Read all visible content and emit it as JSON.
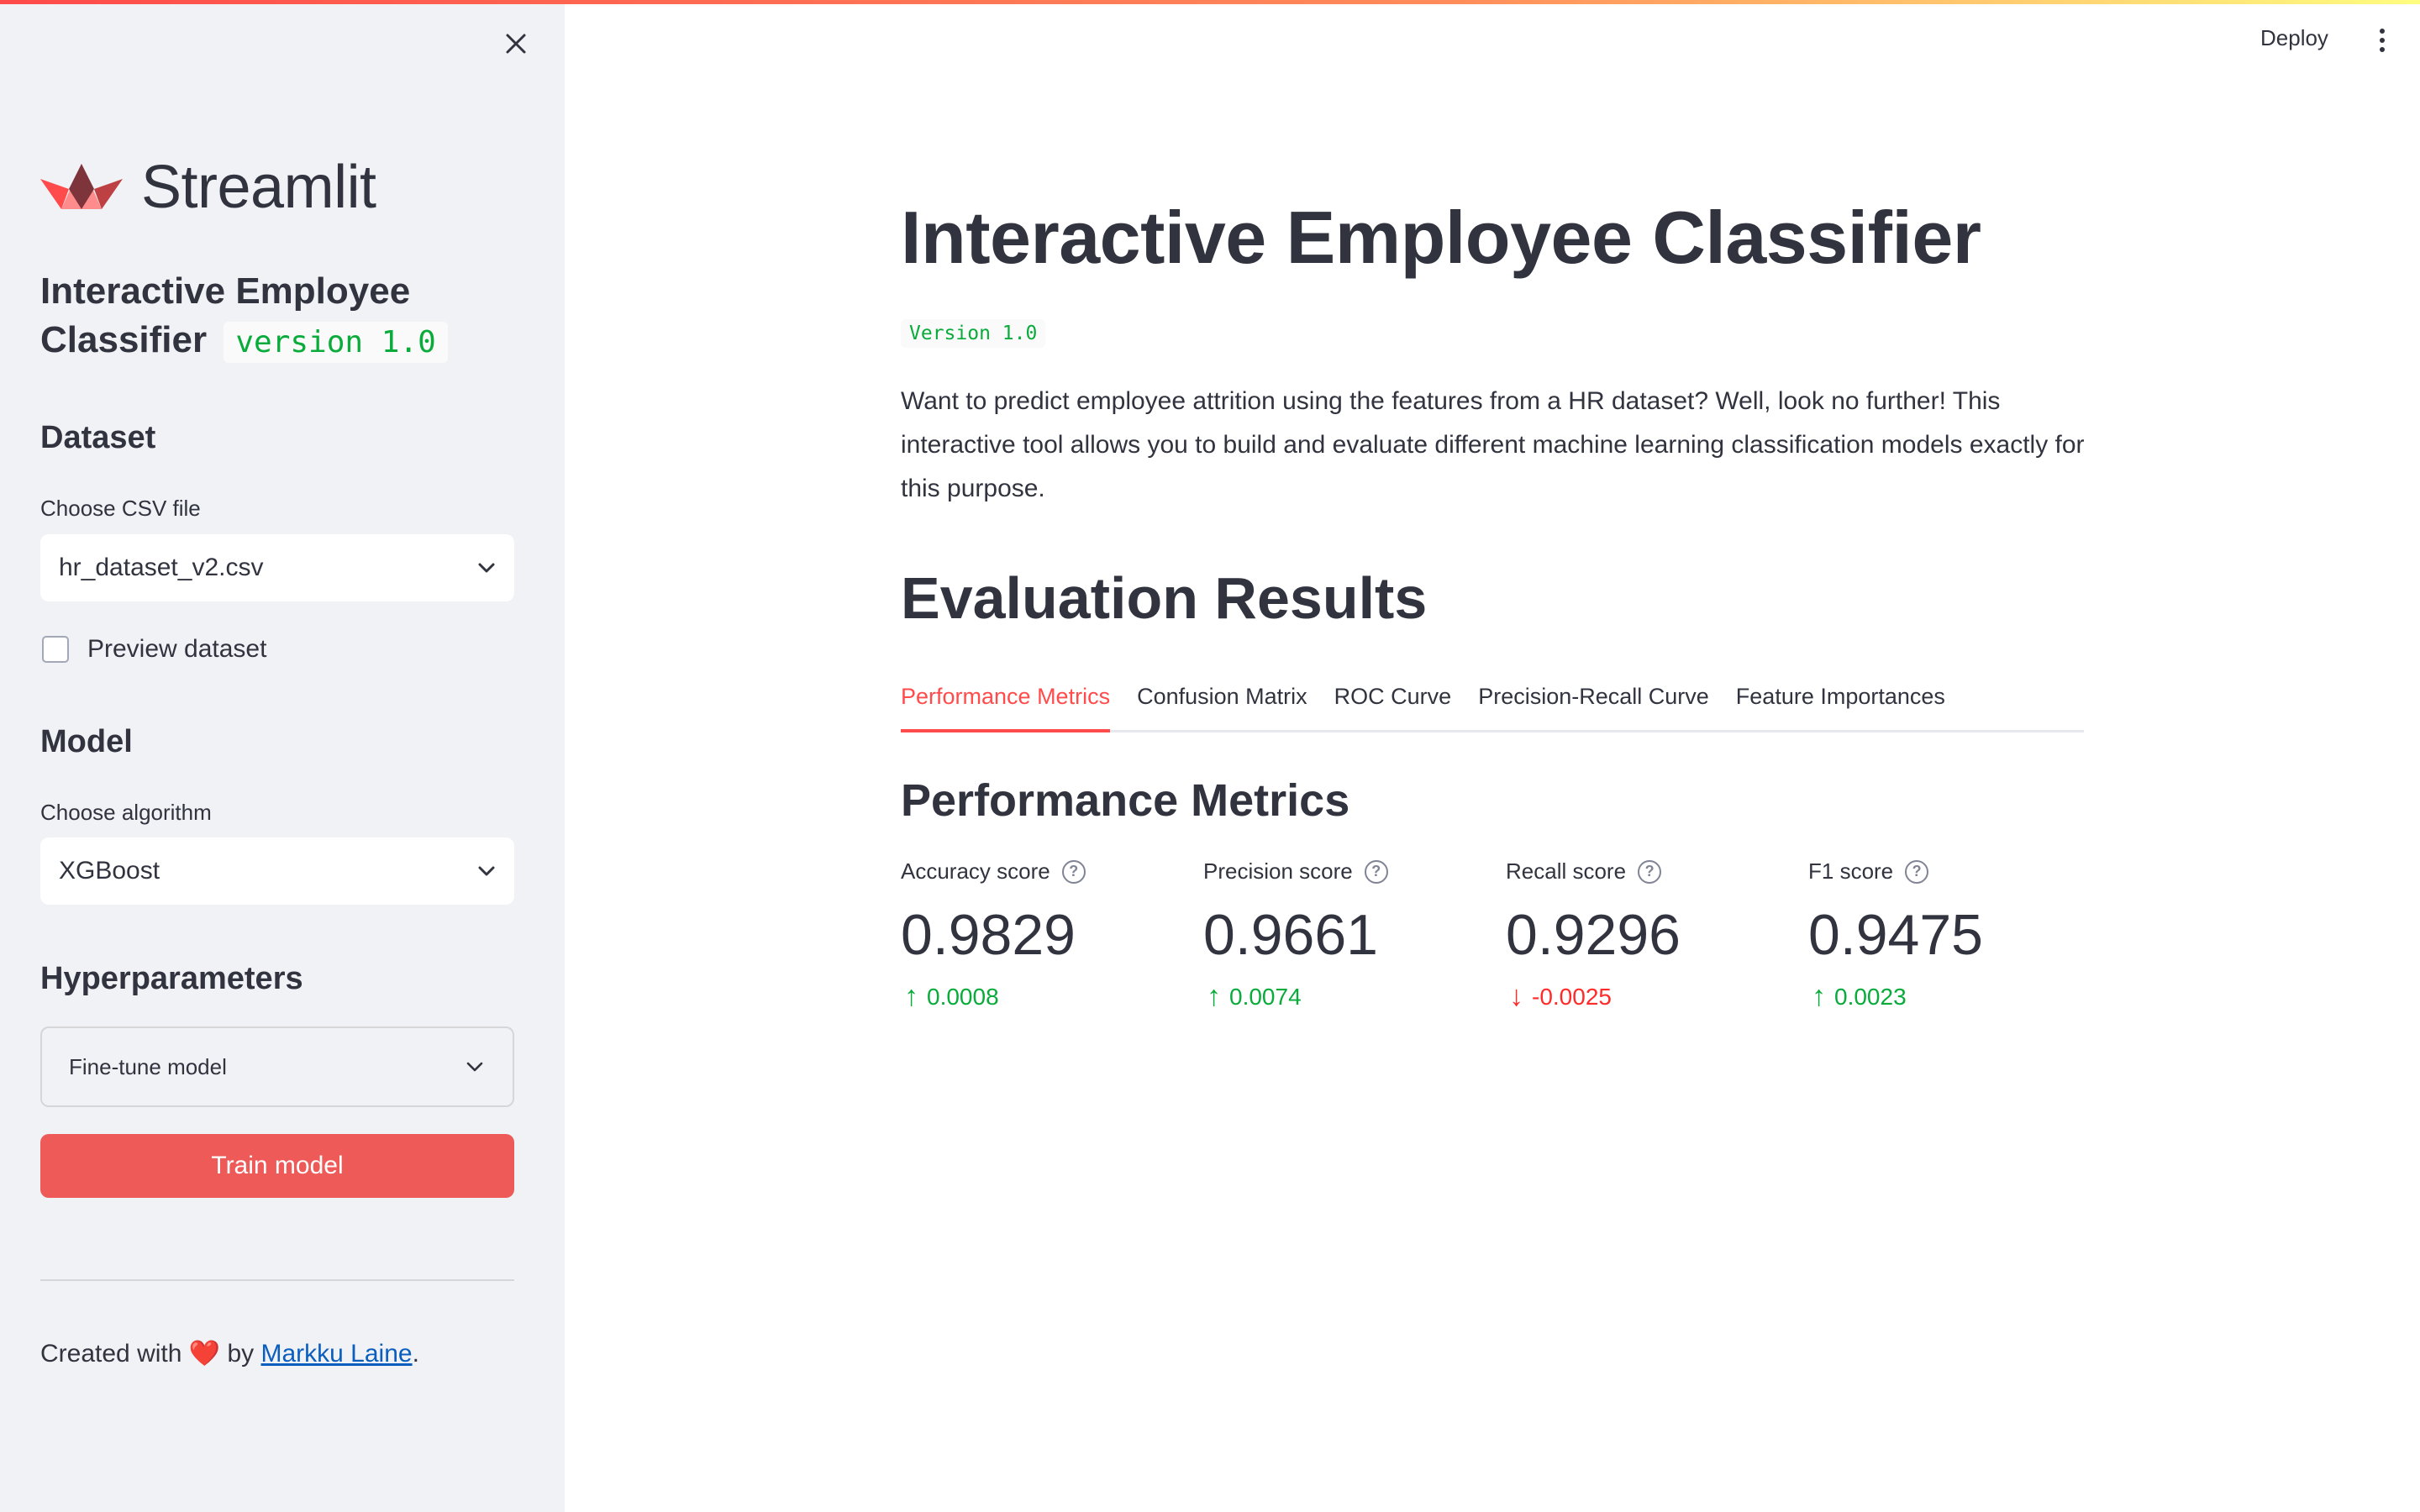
{
  "header": {
    "deploy_label": "Deploy"
  },
  "sidebar": {
    "logo_text": "Streamlit",
    "app_title": "Interactive Employee Classifier",
    "app_version": "version 1.0",
    "dataset": {
      "heading": "Dataset",
      "file_label": "Choose CSV file",
      "file_value": "hr_dataset_v2.csv",
      "preview_label": "Preview dataset",
      "preview_checked": false
    },
    "model": {
      "heading": "Model",
      "algorithm_label": "Choose algorithm",
      "algorithm_value": "XGBoost"
    },
    "hyperparameters": {
      "heading": "Hyperparameters",
      "expander_label": "Fine-tune model",
      "train_button": "Train model"
    },
    "footer": {
      "prefix": "Created with",
      "by": "by",
      "author": "Markku Laine",
      "suffix": "."
    }
  },
  "main": {
    "title": "Interactive Employee Classifier",
    "version": "Version 1.0",
    "intro": "Want to predict employee attrition using the features from a HR dataset? Well, look no further! This interactive tool allows you to build and evaluate different machine learning classification models exactly for this purpose.",
    "results_heading": "Evaluation Results",
    "tabs": [
      {
        "label": "Performance Metrics",
        "active": true
      },
      {
        "label": "Confusion Matrix",
        "active": false
      },
      {
        "label": "ROC Curve",
        "active": false
      },
      {
        "label": "Precision-Recall Curve",
        "active": false
      },
      {
        "label": "Feature Importances",
        "active": false
      }
    ],
    "section_heading": "Performance Metrics",
    "metrics": [
      {
        "label": "Accuracy score",
        "value": "0.9829",
        "delta": "0.0008",
        "direction": "up"
      },
      {
        "label": "Precision score",
        "value": "0.9661",
        "delta": "0.0074",
        "direction": "up"
      },
      {
        "label": "Recall score",
        "value": "0.9296",
        "delta": "-0.0025",
        "direction": "down"
      },
      {
        "label": "F1 score",
        "value": "0.9475",
        "delta": "0.0023",
        "direction": "up"
      }
    ]
  },
  "colors": {
    "accent": "#ff4b4b",
    "button": "#ee5a57",
    "positive": "#09ab3b",
    "negative": "#ff2b2b",
    "sidebar_bg": "#f0f2f6",
    "text": "#31333f",
    "link": "#0b5ebd"
  },
  "icons": {
    "close": "close-icon",
    "chevron": "chevron-down-icon",
    "menu": "kebab-menu-icon",
    "help": "help-circle-icon",
    "arrow_up": "arrow-up-icon",
    "arrow_down": "arrow-down-icon",
    "heart": "heart-icon",
    "logo": "streamlit-logo-icon"
  }
}
